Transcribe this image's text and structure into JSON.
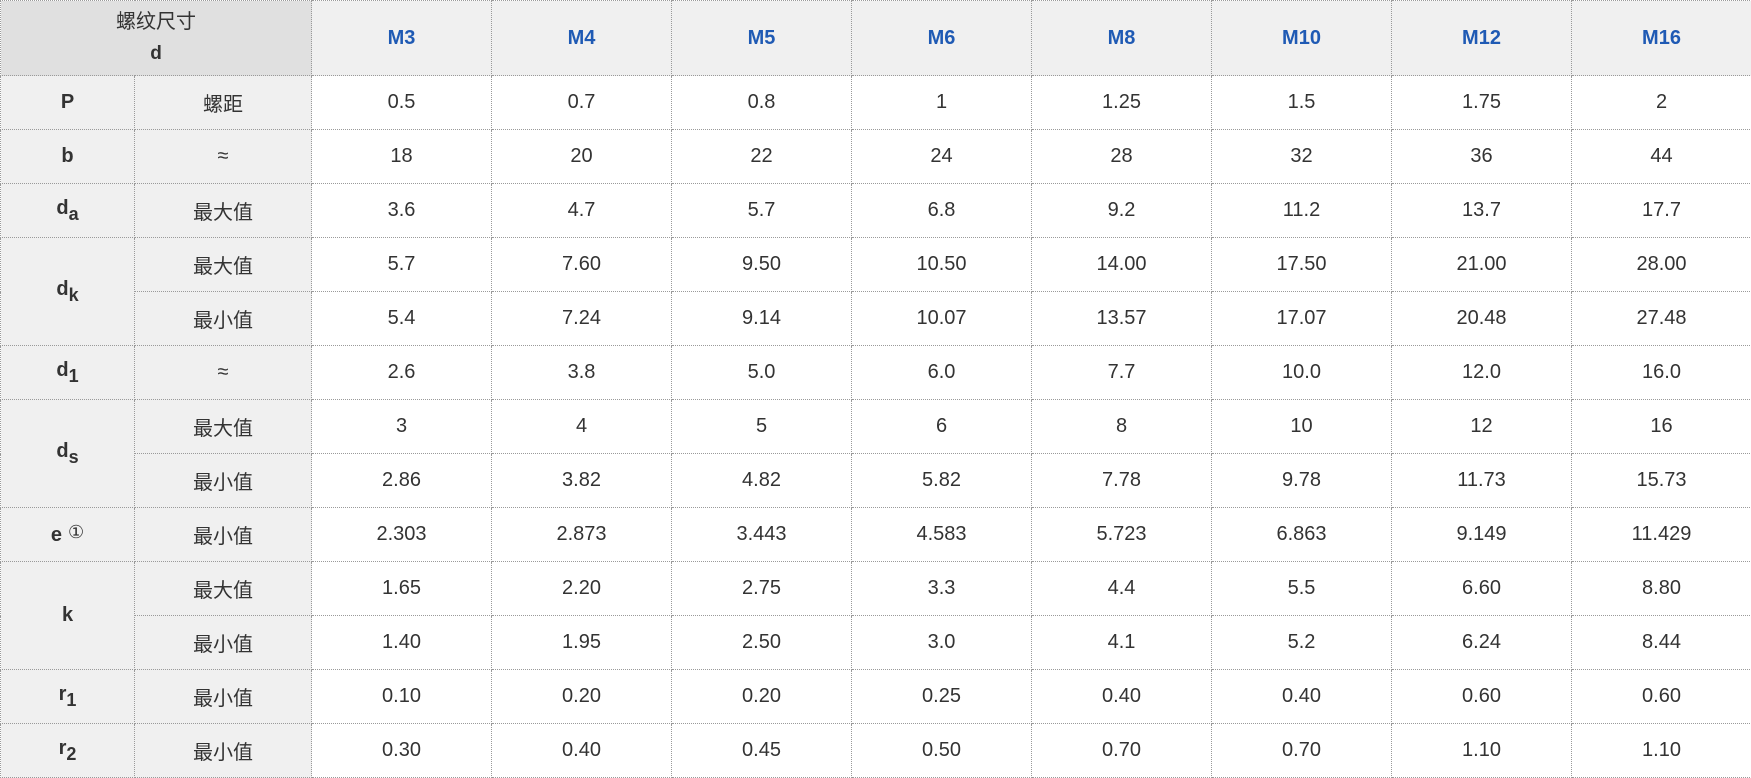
{
  "header": {
    "corner_label": "螺纹尺寸",
    "corner_sub": "d",
    "sizes": [
      "M3",
      "M4",
      "M5",
      "M6",
      "M8",
      "M10",
      "M12",
      "M16"
    ]
  },
  "rows": [
    {
      "sym": "P",
      "sub": "",
      "note": "",
      "desc": "螺距",
      "values": [
        "0.5",
        "0.7",
        "0.8",
        "1",
        "1.25",
        "1.5",
        "1.75",
        "2"
      ]
    },
    {
      "sym": "b",
      "sub": "",
      "note": "",
      "desc": "≈",
      "values": [
        "18",
        "20",
        "22",
        "24",
        "28",
        "32",
        "36",
        "44"
      ]
    },
    {
      "sym": "d",
      "sub": "a",
      "note": "",
      "desc": "最大值",
      "values": [
        "3.6",
        "4.7",
        "5.7",
        "6.8",
        "9.2",
        "11.2",
        "13.7",
        "17.7"
      ]
    },
    {
      "sym": "d",
      "sub": "k",
      "note": "",
      "desc": "最大值",
      "values": [
        "5.7",
        "7.60",
        "9.50",
        "10.50",
        "14.00",
        "17.50",
        "21.00",
        "28.00"
      ]
    },
    {
      "desc": "最小值",
      "values": [
        "5.4",
        "7.24",
        "9.14",
        "10.07",
        "13.57",
        "17.07",
        "20.48",
        "27.48"
      ]
    },
    {
      "sym": "d",
      "sub": "1",
      "note": "",
      "desc": "≈",
      "values": [
        "2.6",
        "3.8",
        "5.0",
        "6.0",
        "7.7",
        "10.0",
        "12.0",
        "16.0"
      ]
    },
    {
      "sym": "d",
      "sub": "s",
      "note": "",
      "desc": "最大值",
      "values": [
        "3",
        "4",
        "5",
        "6",
        "8",
        "10",
        "12",
        "16"
      ]
    },
    {
      "desc": "最小值",
      "values": [
        "2.86",
        "3.82",
        "4.82",
        "5.82",
        "7.78",
        "9.78",
        "11.73",
        "15.73"
      ]
    },
    {
      "sym": "e",
      "sub": "",
      "note": "①",
      "desc": "最小值",
      "values": [
        "2.303",
        "2.873",
        "3.443",
        "4.583",
        "5.723",
        "6.863",
        "9.149",
        "11.429"
      ]
    },
    {
      "sym": "k",
      "sub": "",
      "note": "",
      "desc": "最大值",
      "values": [
        "1.65",
        "2.20",
        "2.75",
        "3.3",
        "4.4",
        "5.5",
        "6.60",
        "8.80"
      ]
    },
    {
      "desc": "最小值",
      "values": [
        "1.40",
        "1.95",
        "2.50",
        "3.0",
        "4.1",
        "5.2",
        "6.24",
        "8.44"
      ]
    },
    {
      "sym": "r",
      "sub": "1",
      "note": "",
      "desc": "最小值",
      "values": [
        "0.10",
        "0.20",
        "0.20",
        "0.25",
        "0.40",
        "0.40",
        "0.60",
        "0.60"
      ]
    },
    {
      "sym": "r",
      "sub": "2",
      "note": "",
      "desc": "最小值",
      "values": [
        "0.30",
        "0.40",
        "0.45",
        "0.50",
        "0.70",
        "0.70",
        "1.10",
        "1.10"
      ]
    }
  ]
}
